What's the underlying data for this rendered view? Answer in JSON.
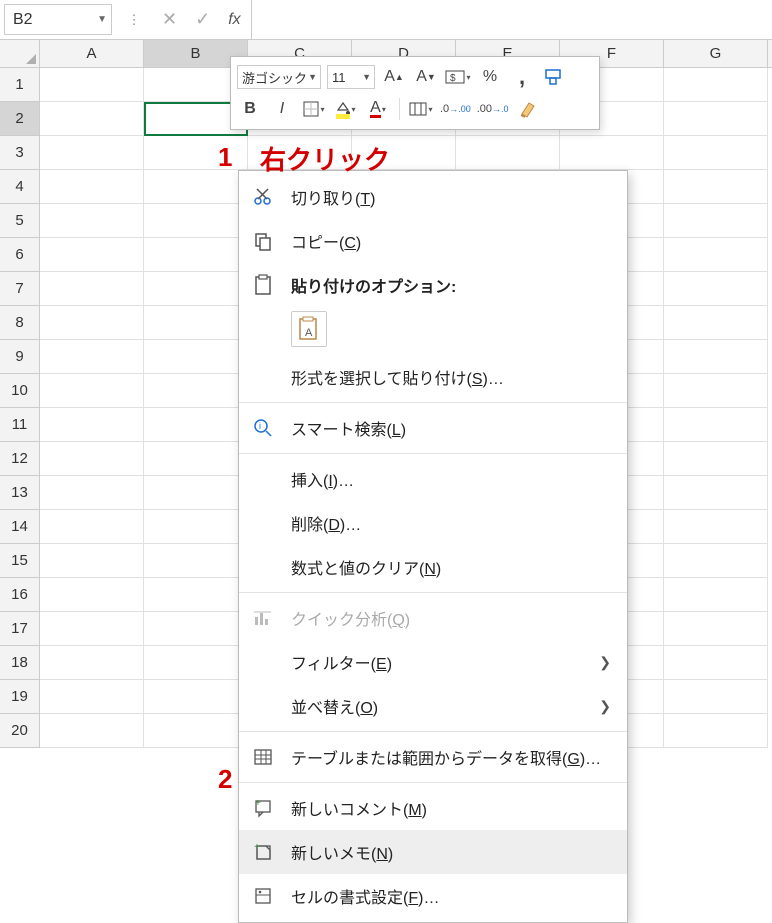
{
  "name_box": "B2",
  "fx_label": "fx",
  "columns": [
    "A",
    "B",
    "C",
    "D",
    "E",
    "F",
    "G"
  ],
  "active_col": "B",
  "rows": [
    "1",
    "2",
    "3",
    "4",
    "5",
    "6",
    "7",
    "8",
    "9",
    "10",
    "11",
    "12",
    "13",
    "14",
    "15",
    "16",
    "17",
    "18",
    "19",
    "20"
  ],
  "active_row": "2",
  "mini_toolbar": {
    "font": "游ゴシック",
    "size": "11"
  },
  "annotations": {
    "a1_num": "1",
    "a1_text": "右クリック",
    "a2_num": "2"
  },
  "context_menu": {
    "cut": "切り取り(",
    "cut_key": "T",
    "cut_suffix": ")",
    "copy": "コピー(",
    "copy_key": "C",
    "copy_suffix": ")",
    "paste_header": "貼り付けのオプション:",
    "paste_special": "形式を選択して貼り付け(",
    "paste_special_key": "S",
    "paste_special_suffix": ")…",
    "smart_lookup": "スマート検索(",
    "smart_lookup_key": "L",
    "smart_lookup_suffix": ")",
    "insert": "挿入(",
    "insert_key": "I",
    "insert_suffix": ")…",
    "delete": "削除(",
    "delete_key": "D",
    "delete_suffix": ")…",
    "clear": "数式と値のクリア(",
    "clear_key": "N",
    "clear_suffix": ")",
    "quick": "クイック分析(",
    "quick_key": "Q",
    "quick_suffix": ")",
    "filter": "フィルター(",
    "filter_key": "E",
    "filter_suffix": ")",
    "sort": "並べ替え(",
    "sort_key": "O",
    "sort_suffix": ")",
    "get_data": "テーブルまたは範囲からデータを取得(",
    "get_data_key": "G",
    "get_data_suffix": ")…",
    "new_comment": "新しいコメント(",
    "new_comment_key": "M",
    "new_comment_suffix": ")",
    "new_note": "新しいメモ(",
    "new_note_key": "N",
    "new_note_suffix": ")",
    "format": "セルの書式設定(",
    "format_key": "F",
    "format_suffix": ")…"
  }
}
